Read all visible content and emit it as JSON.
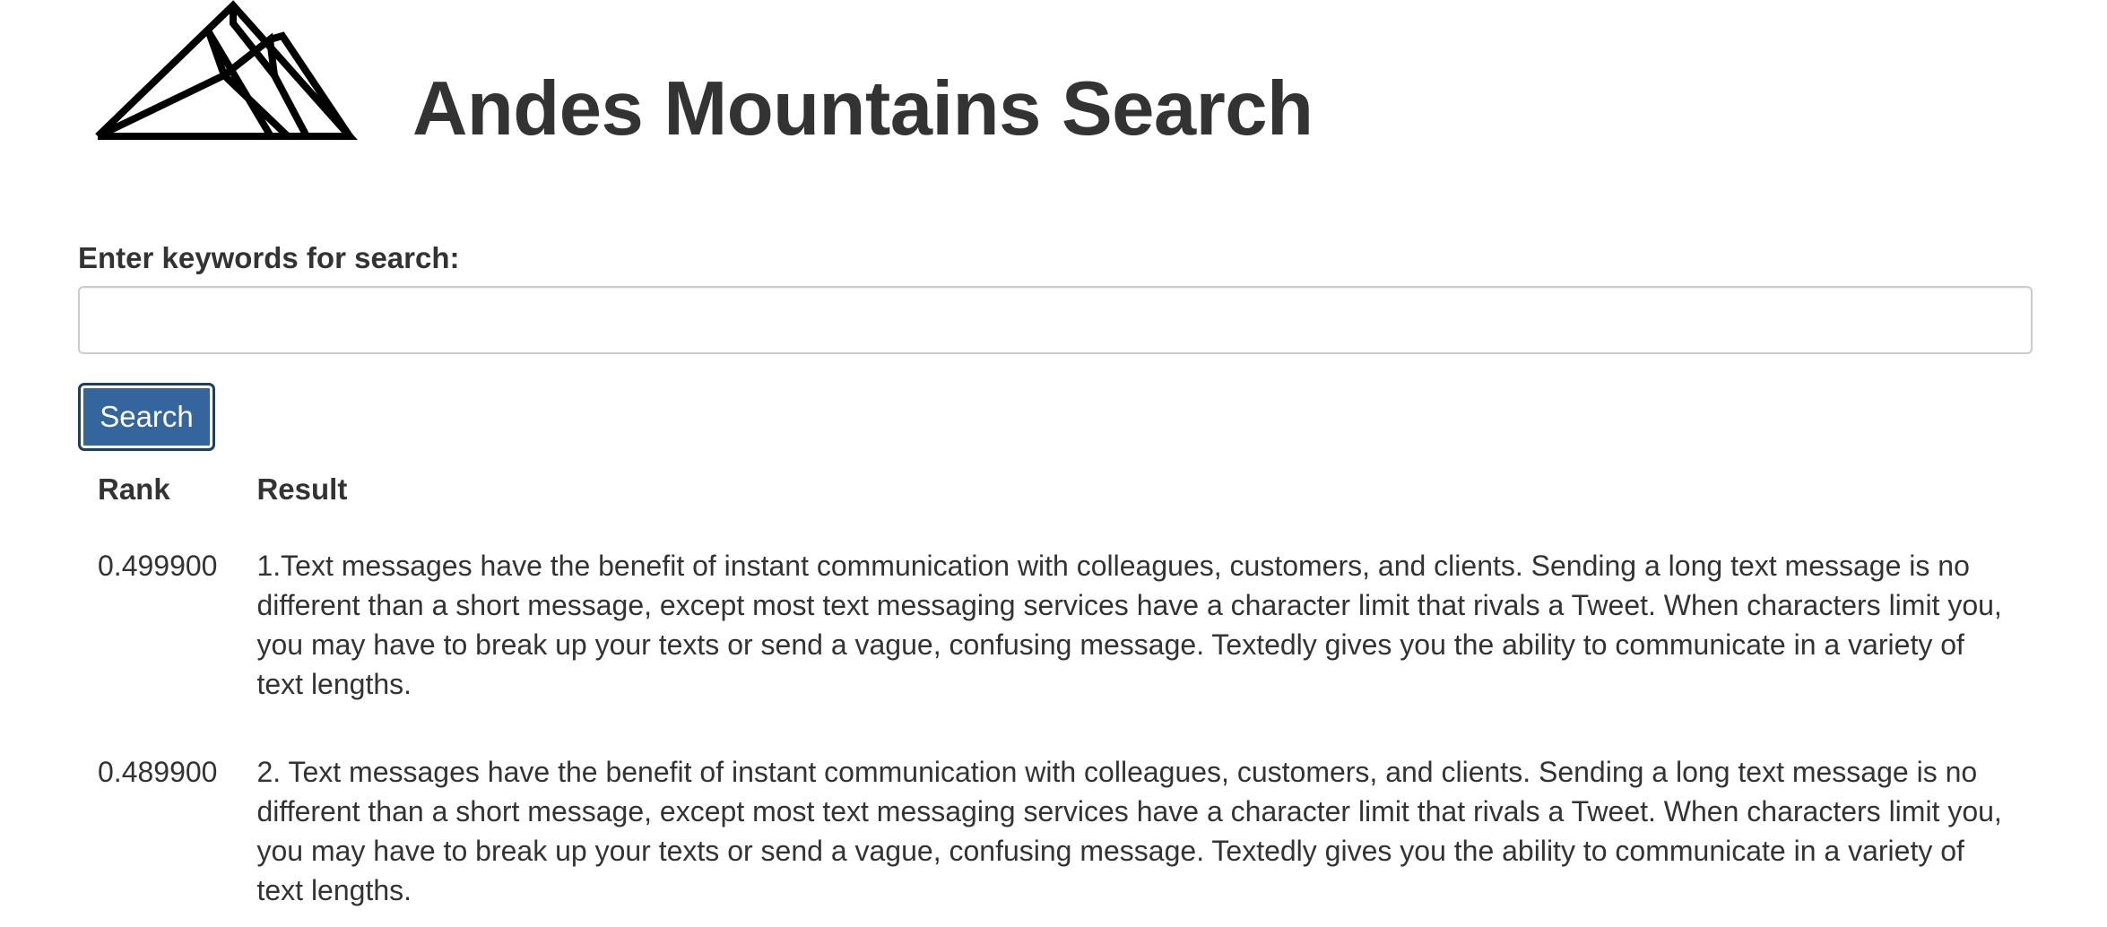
{
  "header": {
    "title": "Andes Mountains Search",
    "logo_icon": "mountain-logo-icon"
  },
  "search": {
    "label": "Enter keywords for search:",
    "value": "",
    "placeholder": "",
    "button_label": "Search",
    "button_color": "#34659c"
  },
  "results_table": {
    "headers": {
      "rank": "Rank",
      "result": "Result"
    },
    "rows": [
      {
        "rank": "0.499900",
        "result": "1.Text messages have the benefit of instant communication with colleagues, customers, and clients. Sending a long text message is no different than a short message, except most text messaging services have a character limit that rivals a Tweet. When characters limit you, you may have to break up your texts or send a vague, confusing message. Textedly gives you the ability to communicate in a variety of text lengths."
      },
      {
        "rank": "0.489900",
        "result": "2. Text messages have the benefit of instant communication with colleagues, customers, and clients. Sending a long text message is no different than a short message, except most text messaging services have a character limit that rivals a Tweet. When characters limit you, you may have to break up your texts or send a vague, confusing message. Textedly gives you the ability to communicate in a variety of text lengths."
      }
    ]
  }
}
